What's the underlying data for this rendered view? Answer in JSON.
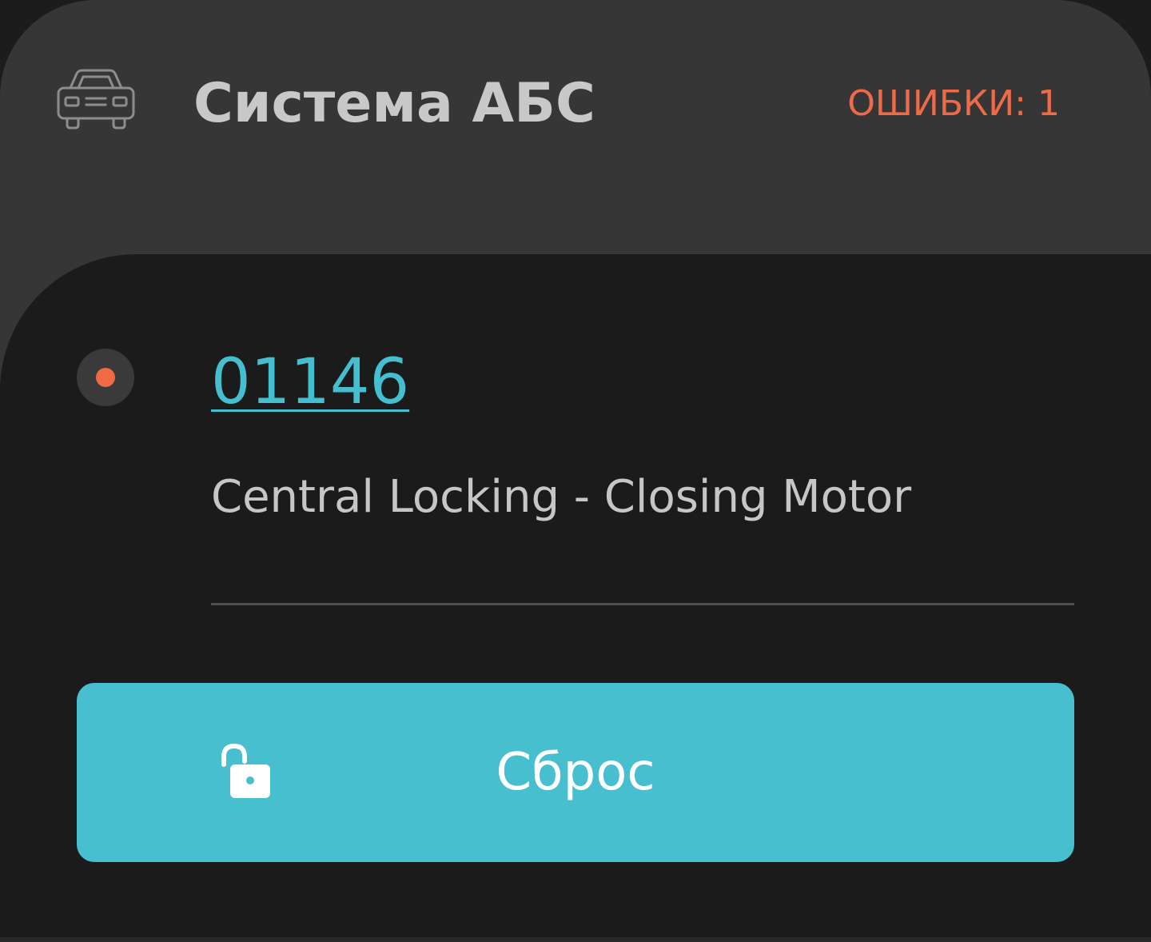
{
  "header": {
    "icon": "car-icon",
    "title": "Система АБС",
    "errors_label": "ОШИБКИ: 1"
  },
  "fault": {
    "status_icon": "error-dot",
    "code": "01146",
    "description": "Central Locking - Closing Motor"
  },
  "reset_button": {
    "icon": "unlock-icon",
    "label": "Сброс"
  },
  "colors": {
    "header_bg": "#363636",
    "body_bg": "#1b1b1b",
    "accent": "#47bfcf",
    "error": "#ef6a48",
    "title_text": "#c8c8c8"
  }
}
